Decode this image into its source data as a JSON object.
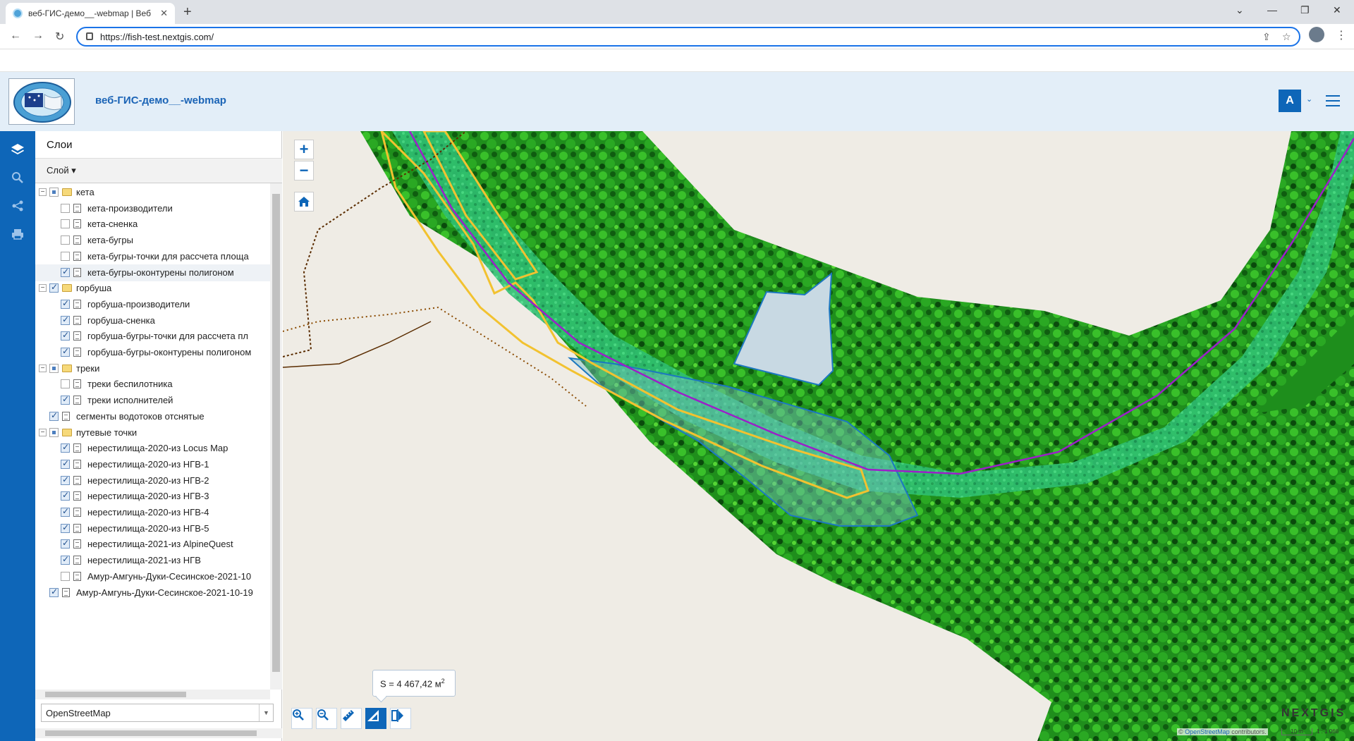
{
  "browser": {
    "tab_title": "веб-ГИС-демо__-webmap | Веб",
    "url": "https://fish-test.nextgis.com/"
  },
  "header": {
    "title": "веб-ГИС-демо__-webmap",
    "user_initial": "A"
  },
  "panel": {
    "title": "Слои",
    "layer_menu": "Слой ▾",
    "basemap": "OpenStreetMap",
    "layers": [
      {
        "label": "кета",
        "level": 0,
        "type": "group",
        "state": "partial"
      },
      {
        "label": "кета-производители",
        "level": 1,
        "type": "layer",
        "state": "off"
      },
      {
        "label": "кета-сненка",
        "level": 1,
        "type": "layer",
        "state": "off"
      },
      {
        "label": "кета-бугры",
        "level": 1,
        "type": "layer",
        "state": "off"
      },
      {
        "label": "кета-бугры-точки для рассчета площа",
        "level": 1,
        "type": "layer",
        "state": "off"
      },
      {
        "label": "кета-бугры-оконтурены полигоном",
        "level": 1,
        "type": "layer",
        "state": "on",
        "selected": true
      },
      {
        "label": "горбуша",
        "level": 0,
        "type": "group",
        "state": "on"
      },
      {
        "label": "горбуша-производители",
        "level": 1,
        "type": "layer",
        "state": "on"
      },
      {
        "label": "горбуша-сненка",
        "level": 1,
        "type": "layer",
        "state": "on"
      },
      {
        "label": "горбуша-бугры-точки для рассчета пл",
        "level": 1,
        "type": "layer",
        "state": "on"
      },
      {
        "label": "горбуша-бугры-оконтурены полигоном",
        "level": 1,
        "type": "layer",
        "state": "on"
      },
      {
        "label": "треки",
        "level": 0,
        "type": "group",
        "state": "partial"
      },
      {
        "label": "треки беспилотника",
        "level": 1,
        "type": "layer",
        "state": "off"
      },
      {
        "label": "треки исполнителей",
        "level": 1,
        "type": "layer",
        "state": "on"
      },
      {
        "label": "сегменты водотоков отснятые",
        "level": 0,
        "type": "layer",
        "state": "on"
      },
      {
        "label": "путевые точки",
        "level": 0,
        "type": "group",
        "state": "partial"
      },
      {
        "label": "нерестилища-2020-из Locus Map",
        "level": 1,
        "type": "layer",
        "state": "on"
      },
      {
        "label": "нерестилища-2020-из НГВ-1",
        "level": 1,
        "type": "layer",
        "state": "on"
      },
      {
        "label": "нерестилища-2020-из НГВ-2",
        "level": 1,
        "type": "layer",
        "state": "on"
      },
      {
        "label": "нерестилища-2020-из НГВ-3",
        "level": 1,
        "type": "layer",
        "state": "on"
      },
      {
        "label": "нерестилища-2020-из НГВ-4",
        "level": 1,
        "type": "layer",
        "state": "on"
      },
      {
        "label": "нерестилища-2020-из НГВ-5",
        "level": 1,
        "type": "layer",
        "state": "on"
      },
      {
        "label": "нерестилища-2021-из AlpineQuest",
        "level": 1,
        "type": "layer",
        "state": "on"
      },
      {
        "label": "нерестилища-2021-из НГВ",
        "level": 1,
        "type": "layer",
        "state": "on"
      },
      {
        "label": "Амур-Амгунь-Дуки-Сесинское-2021-10",
        "level": 1,
        "type": "layer",
        "state": "off"
      },
      {
        "label": "Амур-Амгунь-Дуки-Сесинское-2021-10-19",
        "level": 0,
        "type": "layer",
        "state": "on"
      }
    ]
  },
  "map": {
    "zoom_in": "+",
    "zoom_out": "−",
    "measure_area": "S = 4 467,42 м",
    "measure_unit_exp": "2",
    "brand": "NEXTGIS",
    "attribution_prefix": "© ",
    "attribution_link": "OpenStreetMap",
    "attribution_suffix": " contributors.",
    "scale": "10 m",
    "ratio": "1 : 1 066"
  },
  "colors": {
    "accent": "#0e66b8",
    "header_bg": "#e3eef8",
    "river_line": "#9b1fc9",
    "spawning_outline": "#f2c230",
    "track": "#8a4a00"
  }
}
